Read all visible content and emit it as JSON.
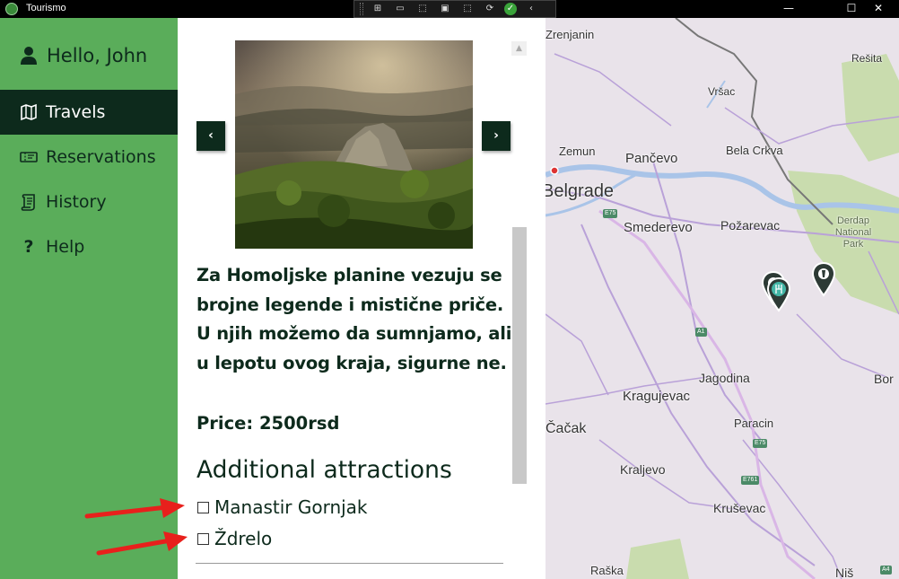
{
  "window": {
    "title": "Tourismo",
    "minimize": "—",
    "maximize": "☐",
    "close": "✕"
  },
  "sidebar": {
    "greeting": "Hello, John",
    "items": [
      {
        "label": "Travels",
        "icon": "map-icon",
        "active": true
      },
      {
        "label": "Reservations",
        "icon": "ticket-icon",
        "active": false
      },
      {
        "label": "History",
        "icon": "scroll-icon",
        "active": false
      },
      {
        "label": "Help",
        "icon": "question-icon",
        "active": false
      }
    ]
  },
  "detail": {
    "description": "Za Homoljske planine vezuju se brojne legende i mistične priče. U njih možemo da sumnjamo, ali u lepotu ovog kraja, sigurne ne.",
    "price": "Price: 2500rsd",
    "attractions_title": "Additional attractions",
    "attractions": [
      {
        "label": "Manastir Gornjak",
        "checked": false
      },
      {
        "label": "Ždrelo",
        "checked": false
      }
    ],
    "prev_label": "‹",
    "next_label": "›"
  },
  "map": {
    "cities": [
      "Zrenjanin",
      "Vršac",
      "Rešita",
      "Zemun",
      "Pančevo",
      "Bela Crkva",
      "Belgrade",
      "Smederevo",
      "Požarevac",
      "Derdap National Park",
      "Jagodina",
      "Kragujevac",
      "Paracin",
      "Čačak",
      "Kraljevo",
      "Kruševac",
      "Raška",
      "Niš",
      "Bor"
    ],
    "roads": [
      "E75",
      "A1",
      "E75",
      "E761",
      "A4"
    ]
  },
  "colors": {
    "sidebar_bg": "#5aad5a",
    "active_bg": "#0d2a1c",
    "text_dark": "#0d2a1c",
    "arrow": "#e8201c"
  }
}
